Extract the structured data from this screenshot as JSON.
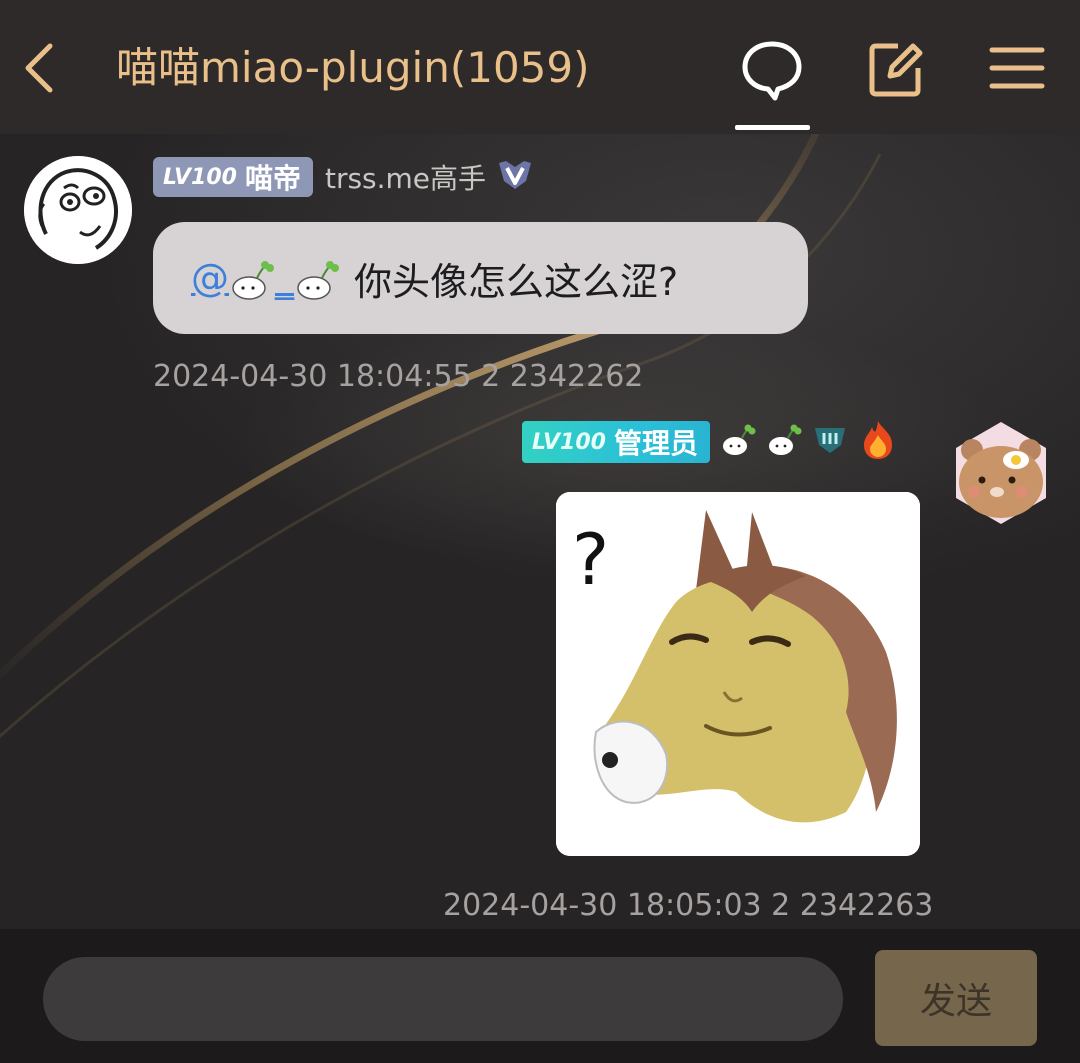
{
  "header": {
    "title": "喵喵miao-plugin(1059)",
    "back_icon": "chevron-left-icon",
    "chat_icon": "speech-bubble-icon",
    "edit_icon": "edit-note-icon",
    "menu_icon": "hamburger-menu-icon",
    "accent_color": "#e9c08a"
  },
  "messages": [
    {
      "side": "left",
      "avatar_icon": "meme-face-avatar-icon",
      "level_badge": {
        "level": "LV100",
        "name": "喵帝",
        "color": "#8e98b6"
      },
      "member_title": "trss.me高手",
      "rank_icon": "v-rank-shield-icon",
      "mention": "@",
      "mention_icons": [
        "bean-sprout-emoji-icon",
        "bean-sprout-emoji-icon"
      ],
      "mention_separator": "_",
      "text": "你头像怎么这么涩?",
      "timestamp": "2024-04-30 18:04:55 2 2342262"
    },
    {
      "side": "right",
      "avatar_icon": "bear-avatar-icon",
      "level_badge": {
        "level": "LV100",
        "name": "管理员",
        "color": "#2ac0d8"
      },
      "name_icons": [
        "bean-sprout-emoji-icon",
        "bean-sprout-emoji-icon",
        "rank-three-shield-icon",
        "fire-icon"
      ],
      "image_icon": "question-horse-sticker-icon",
      "sticker_question_mark": "?",
      "timestamp": "2024-04-30 18:05:03 2 2342263"
    }
  ],
  "input": {
    "value": "",
    "placeholder": ""
  },
  "send_button": {
    "label": "发送",
    "color": "#75664c"
  }
}
